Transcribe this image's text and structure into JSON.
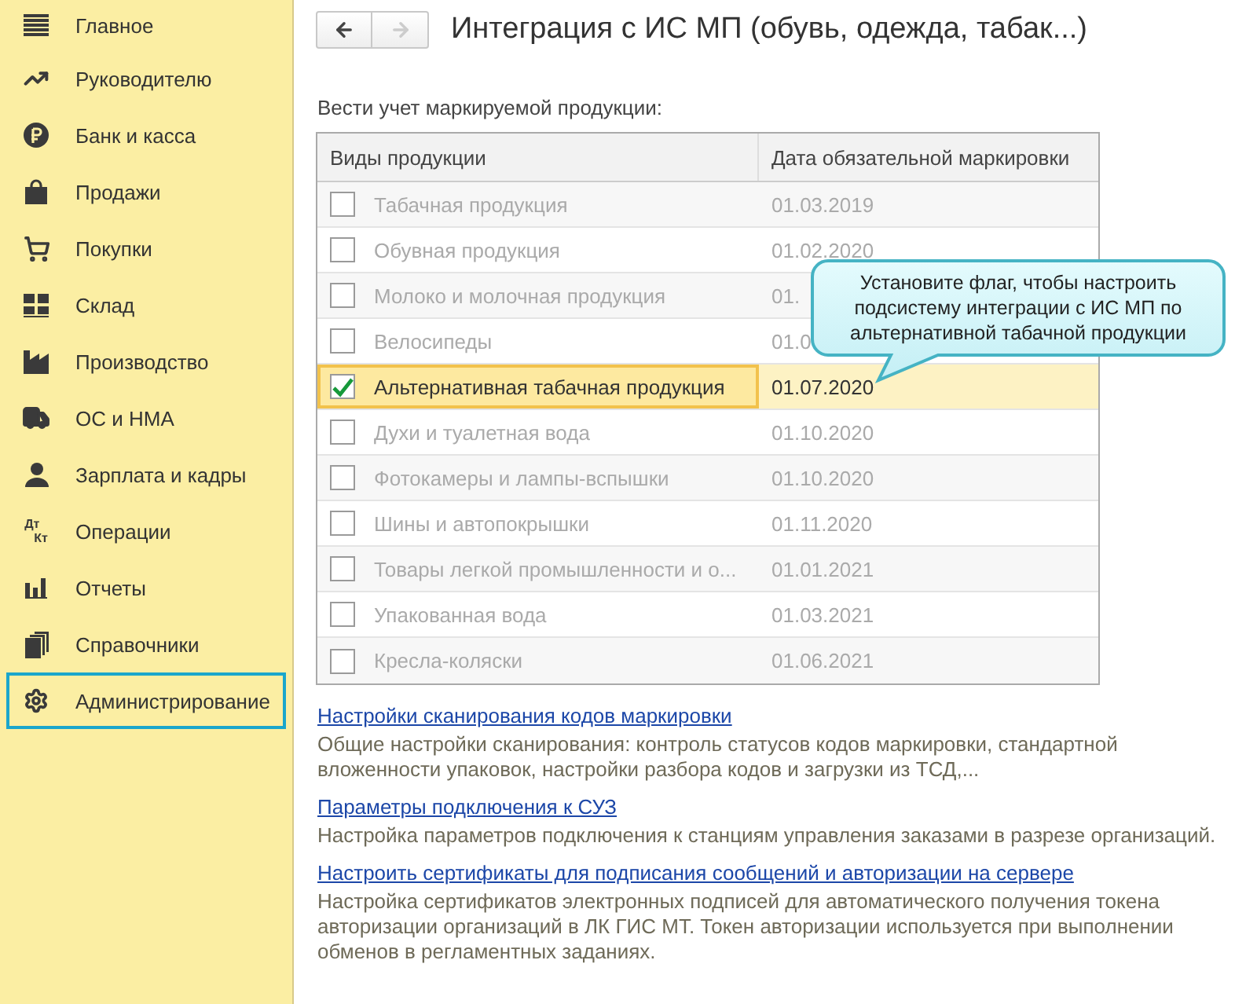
{
  "sidebar": {
    "items": [
      {
        "label": "Главное",
        "selected": false
      },
      {
        "label": "Руководителю",
        "selected": false
      },
      {
        "label": "Банк и касса",
        "selected": false
      },
      {
        "label": "Продажи",
        "selected": false
      },
      {
        "label": "Покупки",
        "selected": false
      },
      {
        "label": "Склад",
        "selected": false
      },
      {
        "label": "Производство",
        "selected": false
      },
      {
        "label": "ОС и НМА",
        "selected": false
      },
      {
        "label": "Зарплата и кадры",
        "selected": false
      },
      {
        "label": "Операции",
        "icon_text": [
          "Дт",
          "Кт"
        ],
        "selected": false
      },
      {
        "label": "Отчеты",
        "selected": false
      },
      {
        "label": "Справочники",
        "selected": false
      },
      {
        "label": "Администрирование",
        "selected": true
      }
    ]
  },
  "title": "Интеграция с ИС МП (обувь, одежда, табак...)",
  "nav": {
    "back_disabled": false,
    "forward_disabled": true
  },
  "section_label": "Вести учет маркируемой продукции:",
  "table": {
    "columns": [
      "Виды продукции",
      "Дата обязательной маркировки"
    ],
    "rows": [
      {
        "name": "Табачная продукция",
        "date": "01.03.2019",
        "checked": false,
        "selected": false
      },
      {
        "name": "Обувная продукция",
        "date": "01.02.2020",
        "checked": false,
        "selected": false
      },
      {
        "name": "Молоко и молочная продукция",
        "date": "01.",
        "checked": false,
        "selected": false
      },
      {
        "name": "Велосипеды",
        "date": "01.0",
        "checked": false,
        "selected": false
      },
      {
        "name": "Альтернативная табачная продукция",
        "date": "01.07.2020",
        "checked": true,
        "selected": true
      },
      {
        "name": "Духи и туалетная вода",
        "date": "01.10.2020",
        "checked": false,
        "selected": false
      },
      {
        "name": "Фотокамеры и лампы-вспышки",
        "date": "01.10.2020",
        "checked": false,
        "selected": false
      },
      {
        "name": "Шины и автопокрышки",
        "date": "01.11.2020",
        "checked": false,
        "selected": false
      },
      {
        "name": "Товары легкой промышленности и о...",
        "date": "01.01.2021",
        "checked": false,
        "selected": false
      },
      {
        "name": "Упакованная вода",
        "date": "01.03.2021",
        "checked": false,
        "selected": false
      },
      {
        "name": "Кресла-коляски",
        "date": "01.06.2021",
        "checked": false,
        "selected": false
      }
    ]
  },
  "callout": {
    "text": "Установите флаг, чтобы настроить подсистему интеграции с ИС МП по альтернативной табачной продукции"
  },
  "settings": [
    {
      "link": "Настройки сканирования кодов маркировки",
      "description": "Общие настройки сканирования: контроль статусов кодов маркировки, стандартной вложенности упаковок, настройки разбора кодов и загрузки из ТСД,..."
    },
    {
      "link": "Параметры подключения к СУЗ",
      "description": "Настройка параметров подключения к станциям управления заказами в разрезе организаций."
    },
    {
      "link": "Настроить сертификаты для подписания сообщений и авторизации на сервере",
      "description": "Настройка сертификатов электронных подписей для автоматического получения токена авторизации организаций в ЛК ГИС МТ. Токен авторизации используется при выполнении обменов в регламентных заданиях."
    }
  ]
}
